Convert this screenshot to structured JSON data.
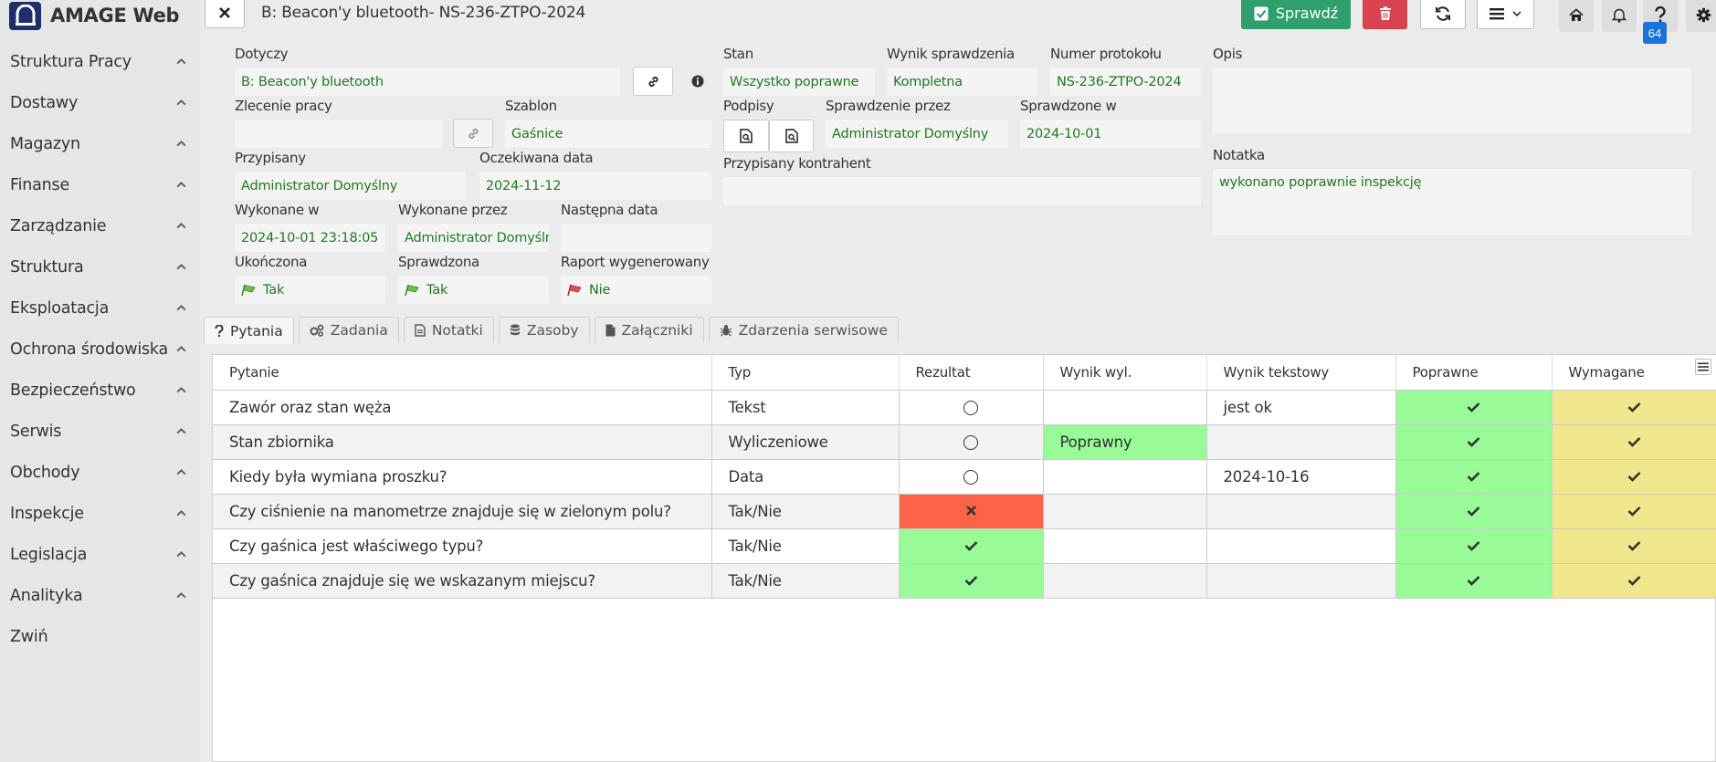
{
  "app": {
    "title": "AMAGE Web"
  },
  "sidebar": {
    "items": [
      {
        "label": "Struktura Pracy"
      },
      {
        "label": "Dostawy"
      },
      {
        "label": "Magazyn"
      },
      {
        "label": "Finanse"
      },
      {
        "label": "Zarządzanie"
      },
      {
        "label": "Struktura"
      },
      {
        "label": "Eksploatacja"
      },
      {
        "label": "Ochrona środowiska"
      },
      {
        "label": "Bezpieczeństwo"
      },
      {
        "label": "Serwis"
      },
      {
        "label": "Obchody"
      },
      {
        "label": "Inspekcje"
      },
      {
        "label": "Legislacja"
      },
      {
        "label": "Analityka"
      }
    ],
    "collapse_label": "Zwiń"
  },
  "topbar": {
    "title": "B: Beacon'y bluetooth- NS-236-ZTPO-2024",
    "check_label": "Sprawdź",
    "help_badge": "64"
  },
  "form": {
    "dotyczy": {
      "label": "Dotyczy",
      "value": "B: Beacon'y bluetooth"
    },
    "zlecenie": {
      "label": "Zlecenie pracy",
      "value": ""
    },
    "szablon": {
      "label": "Szablon",
      "value": "Gaśnice"
    },
    "przypisany": {
      "label": "Przypisany",
      "value": "Administrator Domyślny"
    },
    "oczekiwana": {
      "label": "Oczekiwana data",
      "value": "2024-11-12"
    },
    "wykonane_w": {
      "label": "Wykonane w",
      "value": "2024-10-01 23:18:05"
    },
    "wykonane_przez": {
      "label": "Wykonane przez",
      "value": "Administrator Domyśln"
    },
    "nastepna": {
      "label": "Następna data",
      "value": ""
    },
    "ukonczona": {
      "label": "Ukończona",
      "value": "Tak"
    },
    "sprawdzona": {
      "label": "Sprawdzona",
      "value": "Tak"
    },
    "raport": {
      "label": "Raport wygenerowany",
      "value": "Nie"
    },
    "stan": {
      "label": "Stan",
      "value": "Wszystko poprawne"
    },
    "wynik": {
      "label": "Wynik sprawdzenia",
      "value": "Kompletna"
    },
    "numer": {
      "label": "Numer protokołu",
      "value": "NS-236-ZTPO-2024"
    },
    "opis": {
      "label": "Opis",
      "value": ""
    },
    "podpisy": {
      "label": "Podpisy"
    },
    "sprawdzenie_przez": {
      "label": "Sprawdzenie przez",
      "value": "Administrator Domyślny"
    },
    "sprawdzone_w": {
      "label": "Sprawdzone w",
      "value": "2024-10-01"
    },
    "kontrahent": {
      "label": "Przypisany kontrahent",
      "value": ""
    },
    "notatka": {
      "label": "Notatka",
      "value": "wykonano poprawnie inspekcję"
    }
  },
  "tabs": [
    {
      "label": "Pytania",
      "icon": "question-icon"
    },
    {
      "label": "Zadania",
      "icon": "cogs-icon"
    },
    {
      "label": "Notatki",
      "icon": "note-icon"
    },
    {
      "label": "Zasoby",
      "icon": "database-icon"
    },
    {
      "label": "Załączniki",
      "icon": "file-icon"
    },
    {
      "label": "Zdarzenia serwisowe",
      "icon": "bug-icon"
    }
  ],
  "grid": {
    "columns": [
      "Pytanie",
      "Typ",
      "Rezultat",
      "Wynik wyl.",
      "Wynik tekstowy",
      "Poprawne",
      "Wymagane"
    ],
    "rows": [
      {
        "pytanie": "Zawór oraz stan węża",
        "typ": "Tekst",
        "rezultat": "radio",
        "wynik_wyl": "",
        "wynik_tekstowy": "jest ok",
        "poprawne": "check",
        "wymagane": "check"
      },
      {
        "pytanie": "Stan zbiornika",
        "typ": "Wyliczeniowe",
        "rezultat": "radio",
        "wynik_wyl": "Poprawny",
        "wynik_tekstowy": "",
        "poprawne": "check",
        "wymagane": "check"
      },
      {
        "pytanie": "Kiedy była wymiana proszku?",
        "typ": "Data",
        "rezultat": "radio",
        "wynik_wyl": "",
        "wynik_tekstowy": "2024-10-16",
        "poprawne": "check",
        "wymagane": "check"
      },
      {
        "pytanie": "Czy ciśnienie na manometrze znajduje się w zielonym polu?",
        "typ": "Tak/Nie",
        "rezultat": "cross",
        "wynik_wyl": "",
        "wynik_tekstowy": "",
        "poprawne": "check",
        "wymagane": "check"
      },
      {
        "pytanie": "Czy gaśnica jest właściwego typu?",
        "typ": "Tak/Nie",
        "rezultat": "check",
        "wynik_wyl": "",
        "wynik_tekstowy": "",
        "poprawne": "check",
        "wymagane": "check"
      },
      {
        "pytanie": "Czy gaśnica znajduje się we wskazanym miejscu?",
        "typ": "Tak/Nie",
        "rezultat": "check",
        "wynik_wyl": "",
        "wynik_tekstowy": "",
        "poprawne": "check",
        "wymagane": "check"
      }
    ]
  },
  "colors": {
    "green_cell": "#98fb98",
    "yellow_cell": "#f0e68c",
    "red_cell": "#fe6347",
    "value_text": "#1f7a1f",
    "check_button": "#2f9f6e",
    "delete_button": "#d9434f",
    "badge": "#1a73d9"
  }
}
